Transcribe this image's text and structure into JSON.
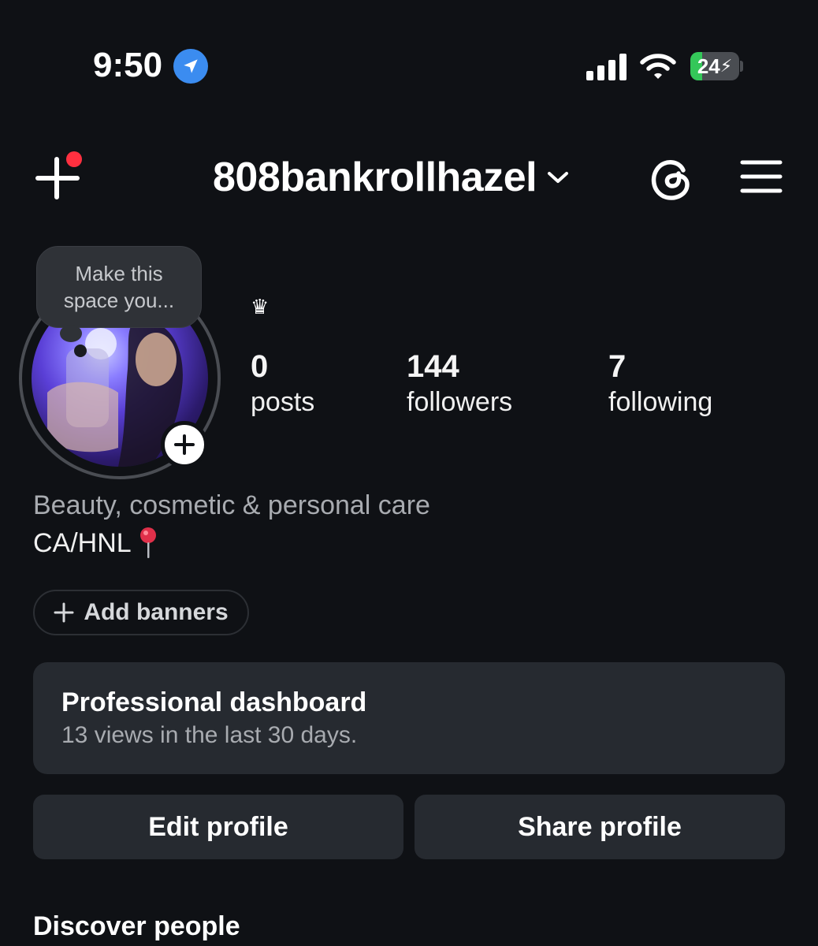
{
  "status_bar": {
    "time": "9:50",
    "battery_level": "24",
    "battery_charging": true,
    "battery_fill_fraction": 0.24,
    "icons": [
      "location-arrow-icon",
      "cellular-signal-icon",
      "wifi-icon",
      "battery-icon"
    ]
  },
  "header": {
    "username": "808bankrollhazel",
    "icons": [
      "create-plus-icon",
      "notification-dot",
      "chevron-down-icon",
      "threads-icon",
      "hamburger-menu-icon"
    ]
  },
  "profile": {
    "note_bubble": "Make this space you...",
    "name": "♛",
    "stats": [
      {
        "count": "0",
        "label": "posts"
      },
      {
        "count": "144",
        "label": "followers"
      },
      {
        "count": "7",
        "label": "following"
      }
    ],
    "category": "Beauty, cosmetic & personal care",
    "bio": "CA/HNL"
  },
  "banners_button": {
    "label": "Add banners"
  },
  "dashboard": {
    "title": "Professional dashboard",
    "subtitle": "13 views in the last 30 days."
  },
  "actions": {
    "edit_label": "Edit profile",
    "share_label": "Share profile"
  },
  "discover": {
    "title": "Discover people"
  },
  "colors": {
    "background": "#0f1115",
    "card": "#262a30",
    "notification": "#ff3040",
    "location_blue": "#3b8cf0",
    "battery_green": "#34c759"
  }
}
